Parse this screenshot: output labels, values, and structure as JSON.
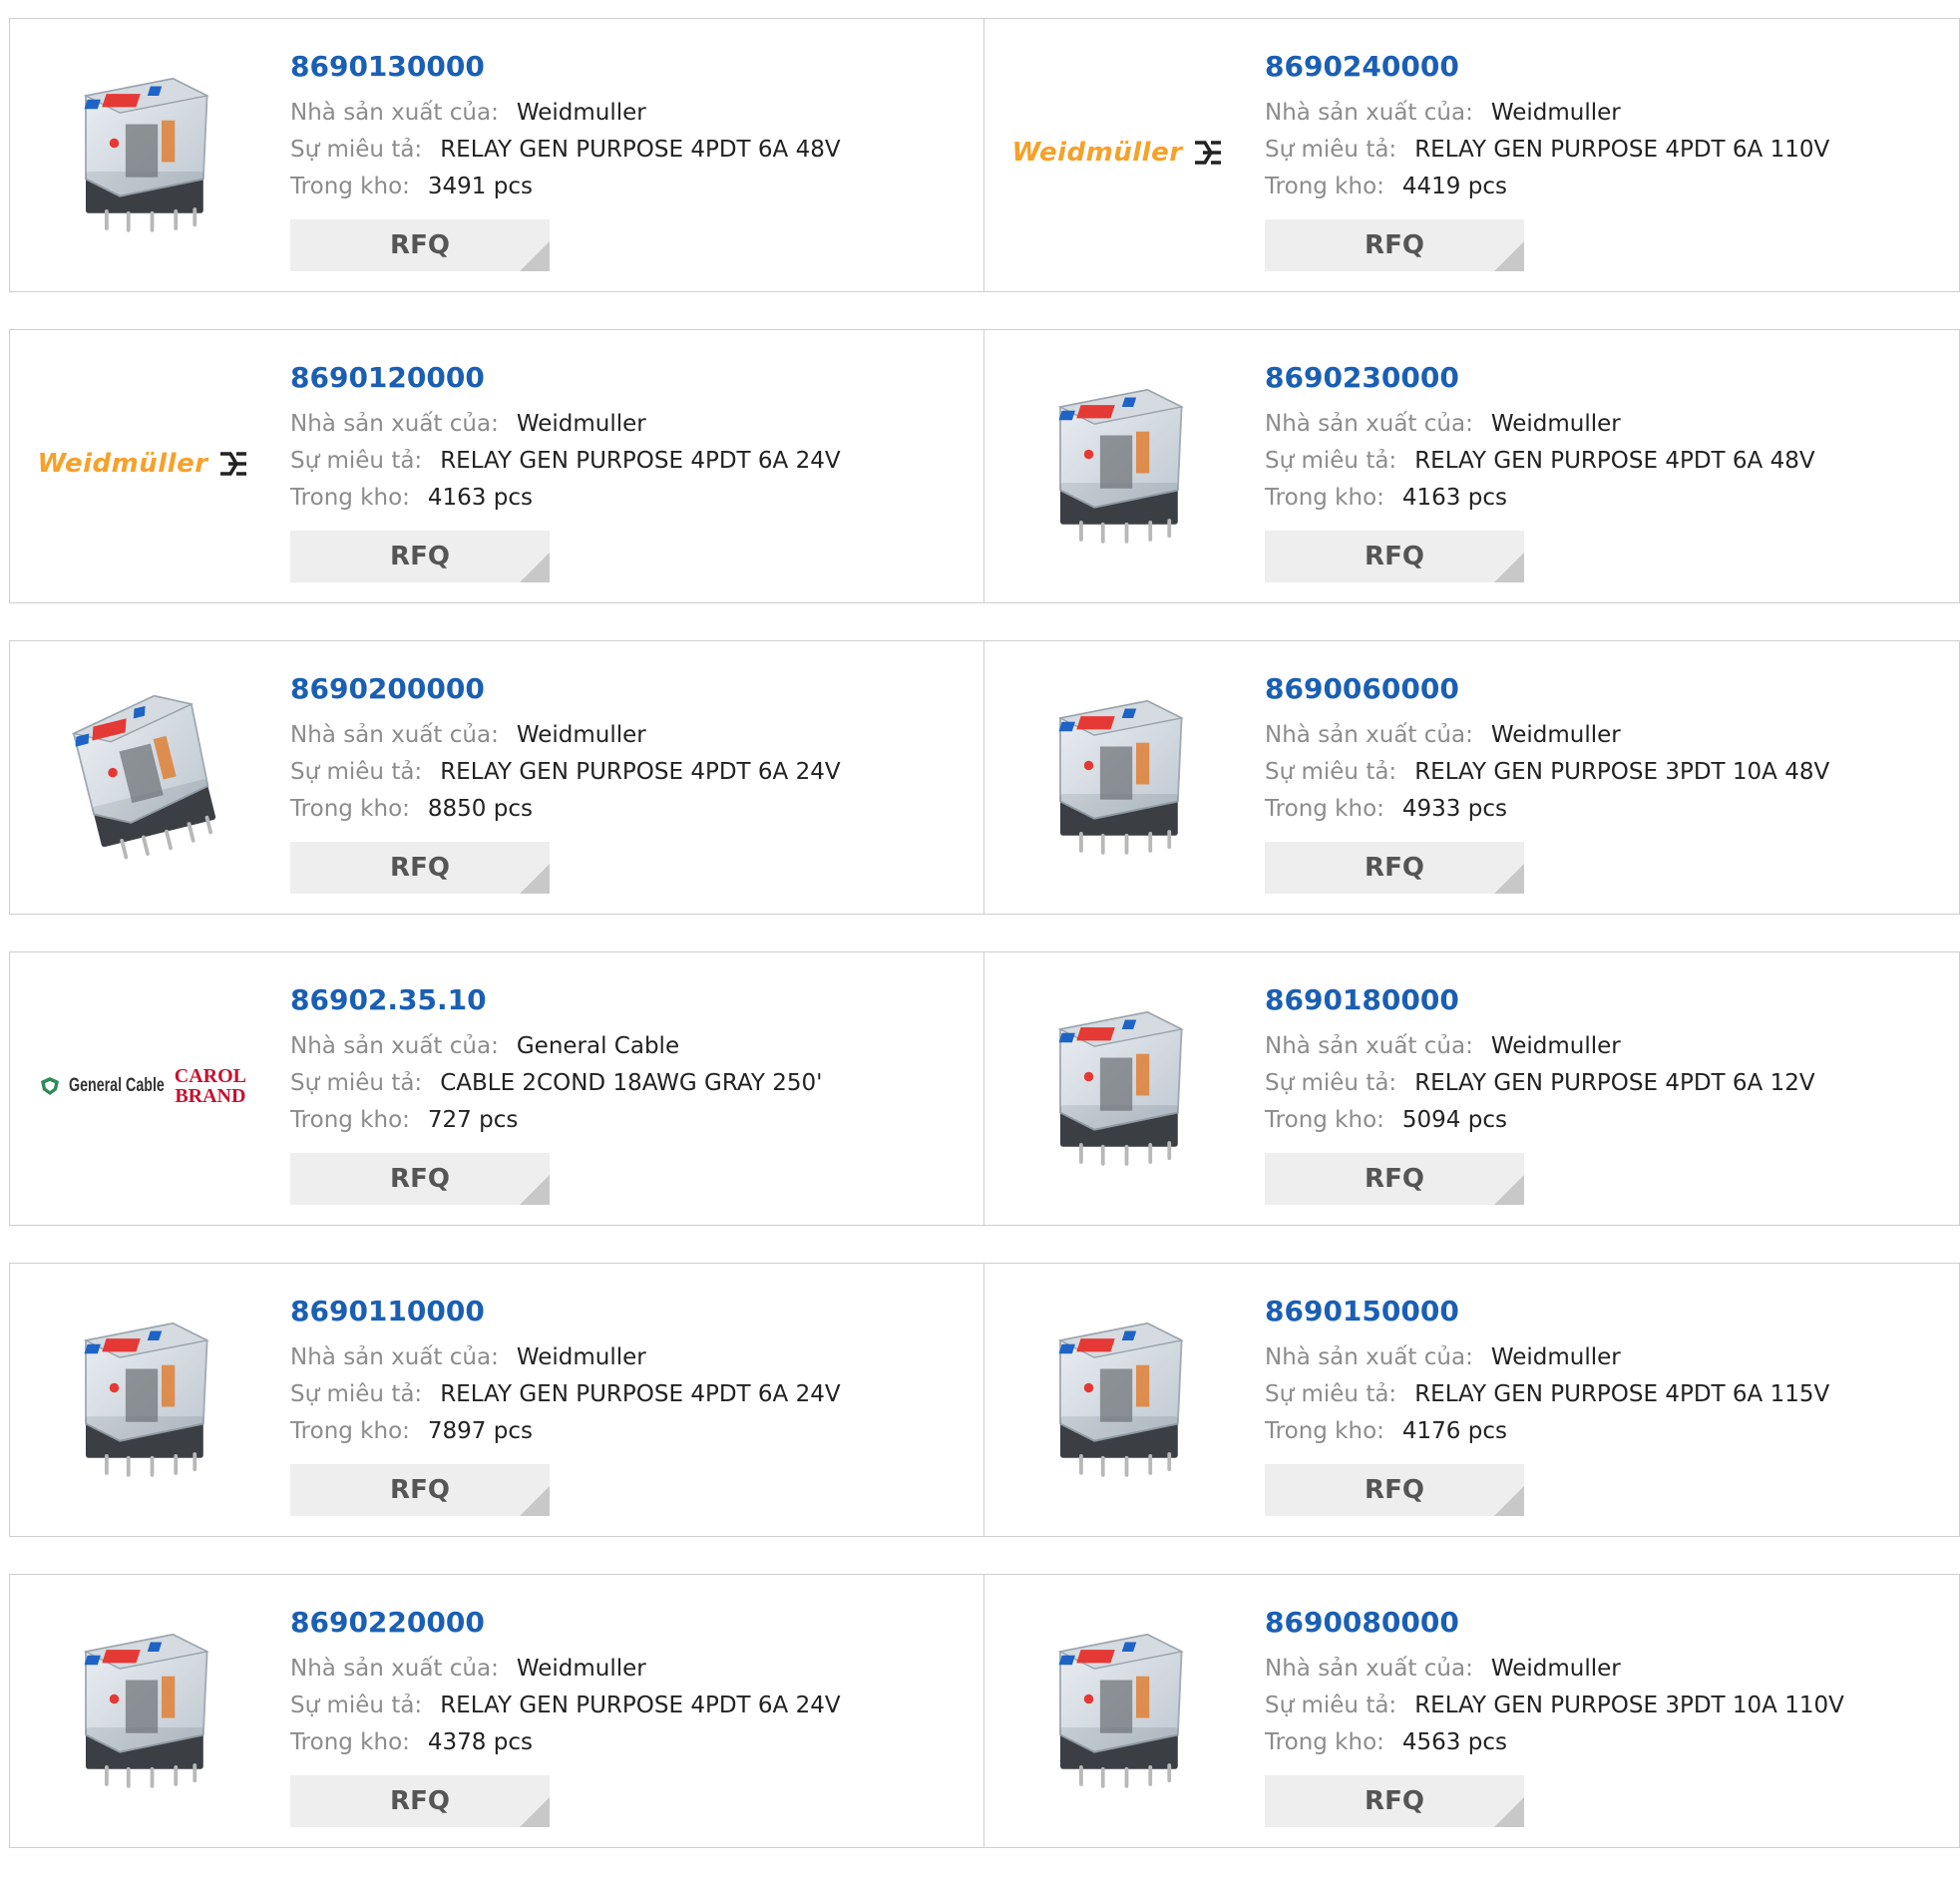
{
  "labels": {
    "manufacturer": "Nhà sản xuất của:",
    "description": "Sự miêu tả:",
    "stock": "Trong kho:",
    "rfq": "RFQ"
  },
  "brand_colors": {
    "part_link": "#1a5fb4",
    "weidmuller_orange": "#f5a12a",
    "carol_red": "#c8102e",
    "general_cable_green": "#2e8b57"
  },
  "products": [
    {
      "part": "8690130000",
      "manufacturer": "Weidmuller",
      "description": "RELAY GEN PURPOSE 4PDT 6A 48V",
      "stock": "3491 pcs",
      "image": "relay-photo"
    },
    {
      "part": "8690240000",
      "manufacturer": "Weidmuller",
      "description": "RELAY GEN PURPOSE 4PDT 6A 110V",
      "stock": "4419 pcs",
      "image": "weidmuller-logo",
      "logo_text": "Weidmüller"
    },
    {
      "part": "8690120000",
      "manufacturer": "Weidmuller",
      "description": "RELAY GEN PURPOSE 4PDT 6A 24V",
      "stock": "4163 pcs",
      "image": "weidmuller-logo",
      "logo_text": "Weidmüller"
    },
    {
      "part": "8690230000",
      "manufacturer": "Weidmuller",
      "description": "RELAY GEN PURPOSE 4PDT 6A 48V",
      "stock": "4163 pcs",
      "image": "relay-photo"
    },
    {
      "part": "8690200000",
      "manufacturer": "Weidmuller",
      "description": "RELAY GEN PURPOSE 4PDT 6A 24V",
      "stock": "8850 pcs",
      "image": "relay-photo-angled"
    },
    {
      "part": "8690060000",
      "manufacturer": "Weidmuller",
      "description": "RELAY GEN PURPOSE 3PDT 10A 48V",
      "stock": "4933 pcs",
      "image": "relay-photo"
    },
    {
      "part": "86902.35.10",
      "manufacturer": "General Cable",
      "description": "CABLE 2COND 18AWG GRAY 250'",
      "stock": "727 pcs",
      "image": "general-cable-logo",
      "logo_text": "General Cable",
      "logo_text_2": "CAROL",
      "logo_text_3": "BRAND"
    },
    {
      "part": "8690180000",
      "manufacturer": "Weidmuller",
      "description": "RELAY GEN PURPOSE 4PDT 6A 12V",
      "stock": "5094 pcs",
      "image": "relay-photo"
    },
    {
      "part": "8690110000",
      "manufacturer": "Weidmuller",
      "description": "RELAY GEN PURPOSE 4PDT 6A 24V",
      "stock": "7897 pcs",
      "image": "relay-photo"
    },
    {
      "part": "8690150000",
      "manufacturer": "Weidmuller",
      "description": "RELAY GEN PURPOSE 4PDT 6A 115V",
      "stock": "4176 pcs",
      "image": "relay-photo"
    },
    {
      "part": "8690220000",
      "manufacturer": "Weidmuller",
      "description": "RELAY GEN PURPOSE 4PDT 6A 24V",
      "stock": "4378 pcs",
      "image": "relay-photo"
    },
    {
      "part": "8690080000",
      "manufacturer": "Weidmuller",
      "description": "RELAY GEN PURPOSE 3PDT 10A 110V",
      "stock": "4563 pcs",
      "image": "relay-photo"
    }
  ]
}
